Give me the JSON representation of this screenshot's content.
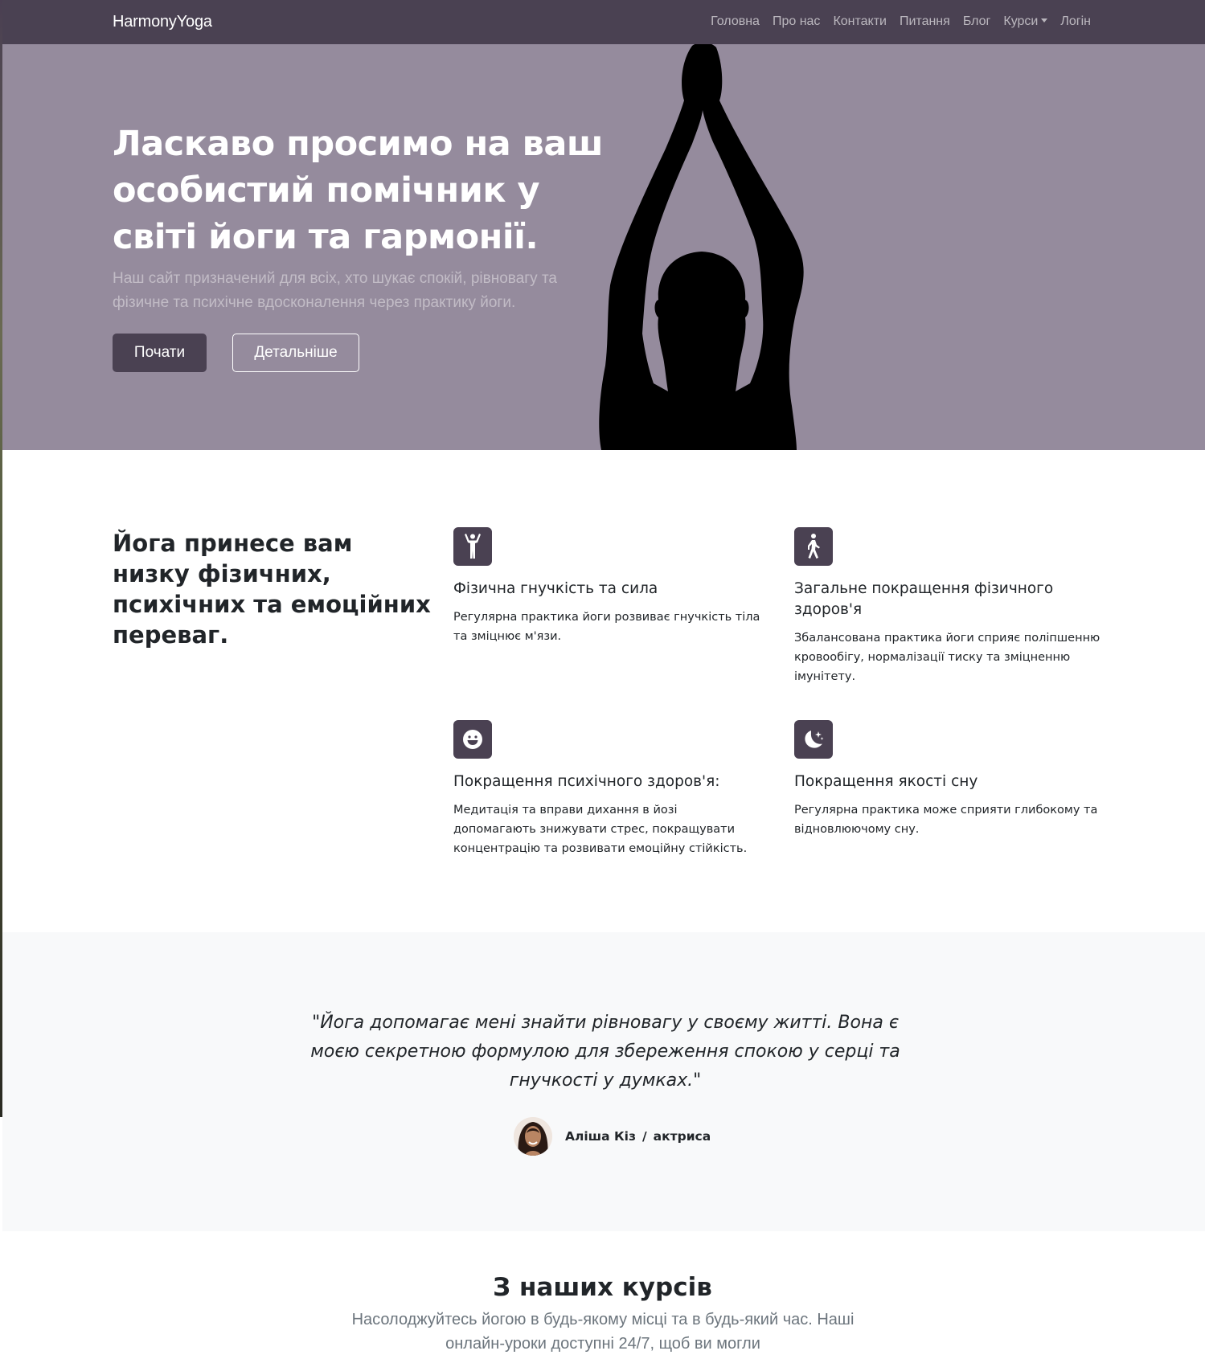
{
  "nav": {
    "brand": "HarmonyYoga",
    "links": [
      "Головна",
      "Про нас",
      "Контакти",
      "Питання",
      "Блог",
      "Курси",
      "Логін"
    ]
  },
  "hero": {
    "title": "Ласкаво просимо на ваш особистий помічник у світі йоги та гармонії.",
    "lead": "Наш сайт призначений для всіх, хто шукає спокій, рівновагу та фізичне та психічне вдосконалення через практику йоги.",
    "primary_button": "Почати",
    "secondary_button": "Детальніше"
  },
  "benefits": {
    "title": "Йога принесе вам низку фізичних, психічних та емоційних переваг.",
    "items": [
      {
        "icon": "person-arms-up-icon",
        "title": "Фізична гнучкість та сила",
        "text": "Регулярна практика йоги розвиває гнучкість тіла та зміцнює м'язи."
      },
      {
        "icon": "person-walking-icon",
        "title": "Загальне покращення фізичного здоров'я",
        "text": "Збалансована практика йоги сприяє поліпшенню кровообігу, нормалізації тиску та зміцненню імунітету."
      },
      {
        "icon": "smile-icon",
        "title": "Покращення психічного здоров'я:",
        "text": "Медитація та вправи дихання в йозі допомагають знижувати стрес, покращувати концентрацію та розвивати емоційну стійкість."
      },
      {
        "icon": "moon-stars-icon",
        "title": "Покращення якості сну",
        "text": "Регулярна практика може сприяти глибокому та відновлюючому сну."
      }
    ]
  },
  "testimonial": {
    "quote": "\"Йога допомагає мені знайти рівновагу у своєму житті. Вона є моєю секретною формулою для збереження спокою у серці та гнучкості у думках.\"",
    "author": "Аліша Кіз",
    "separator": "/",
    "role": "актриса"
  },
  "courses": {
    "title": "З наших курсів",
    "subtitle": "Насолоджуйтесь йогою в будь-якому місці та в будь-який час. Наші онлайн-уроки доступні 24/7, щоб ви могли"
  },
  "colors": {
    "nav_bg": "#4a4152",
    "hero_bg": "#958b9d",
    "icon_bg": "#4a4152",
    "testimonial_bg": "#f8f9fa"
  }
}
